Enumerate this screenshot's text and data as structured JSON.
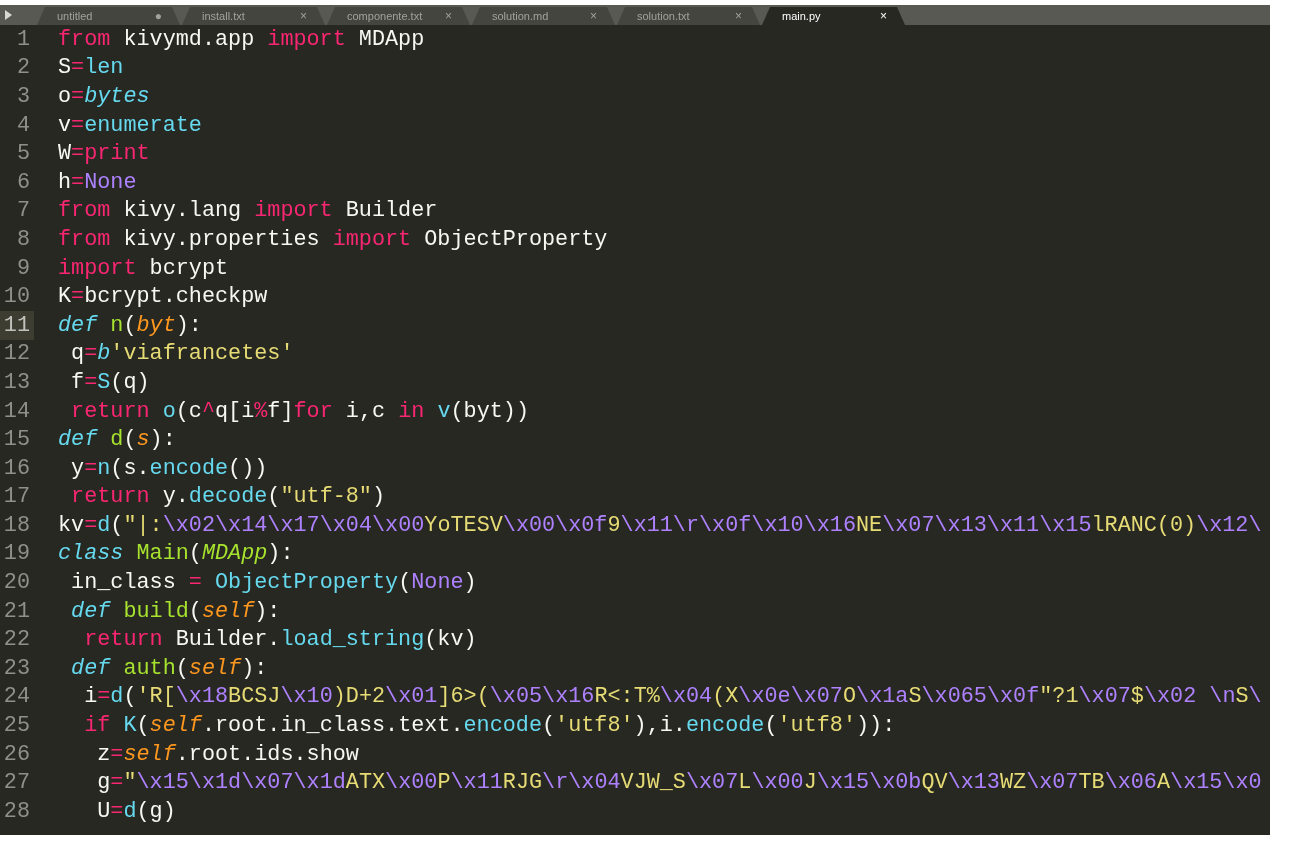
{
  "tabs": [
    {
      "label": "untitled",
      "marker": "●",
      "selected": false
    },
    {
      "label": "install.txt",
      "marker": "×",
      "selected": false
    },
    {
      "label": "componente.txt",
      "marker": "×",
      "selected": false
    },
    {
      "label": "solution.md",
      "marker": "×",
      "selected": false
    },
    {
      "label": "solution.txt",
      "marker": "×",
      "selected": false
    },
    {
      "label": "main.py",
      "marker": "×",
      "selected": true
    }
  ],
  "lines": [
    {
      "number": "1",
      "current": false,
      "tokens": [
        {
          "kind": "kw",
          "text": "from"
        },
        {
          "kind": "plain",
          "text": " kivymd.app "
        },
        {
          "kind": "kw",
          "text": "import"
        },
        {
          "kind": "plain",
          "text": " MDApp"
        }
      ]
    },
    {
      "number": "2",
      "current": false,
      "tokens": [
        {
          "kind": "plain",
          "text": "S"
        },
        {
          "kind": "kw",
          "text": "="
        },
        {
          "kind": "builtin",
          "text": "len"
        }
      ]
    },
    {
      "number": "3",
      "current": false,
      "tokens": [
        {
          "kind": "plain",
          "text": "o"
        },
        {
          "kind": "kw",
          "text": "="
        },
        {
          "kind": "storage",
          "text": "bytes"
        }
      ]
    },
    {
      "number": "4",
      "current": false,
      "tokens": [
        {
          "kind": "plain",
          "text": "v"
        },
        {
          "kind": "kw",
          "text": "="
        },
        {
          "kind": "builtin",
          "text": "enumerate"
        }
      ]
    },
    {
      "number": "5",
      "current": false,
      "tokens": [
        {
          "kind": "plain",
          "text": "W"
        },
        {
          "kind": "kw",
          "text": "="
        },
        {
          "kind": "kw",
          "text": "print"
        }
      ]
    },
    {
      "number": "6",
      "current": false,
      "tokens": [
        {
          "kind": "plain",
          "text": "h"
        },
        {
          "kind": "kw",
          "text": "="
        },
        {
          "kind": "const",
          "text": "None"
        }
      ]
    },
    {
      "number": "7",
      "current": false,
      "tokens": [
        {
          "kind": "kw",
          "text": "from"
        },
        {
          "kind": "plain",
          "text": " kivy.lang "
        },
        {
          "kind": "kw",
          "text": "import"
        },
        {
          "kind": "plain",
          "text": " Builder"
        }
      ]
    },
    {
      "number": "8",
      "current": false,
      "tokens": [
        {
          "kind": "kw",
          "text": "from"
        },
        {
          "kind": "plain",
          "text": " kivy.properties "
        },
        {
          "kind": "kw",
          "text": "import"
        },
        {
          "kind": "plain",
          "text": " ObjectProperty"
        }
      ]
    },
    {
      "number": "9",
      "current": false,
      "tokens": [
        {
          "kind": "kw",
          "text": "import"
        },
        {
          "kind": "plain",
          "text": " bcrypt"
        }
      ]
    },
    {
      "number": "10",
      "current": false,
      "tokens": [
        {
          "kind": "plain",
          "text": "K"
        },
        {
          "kind": "kw",
          "text": "="
        },
        {
          "kind": "plain",
          "text": "bcrypt.checkpw"
        }
      ]
    },
    {
      "number": "11",
      "current": true,
      "tokens": [
        {
          "kind": "storage",
          "text": "def"
        },
        {
          "kind": "fn",
          "text": " n"
        },
        {
          "kind": "plain",
          "text": "("
        },
        {
          "kind": "param",
          "text": "byt"
        },
        {
          "kind": "plain",
          "text": "):"
        }
      ]
    },
    {
      "number": "12",
      "current": false,
      "tokens": [
        {
          "kind": "plain",
          "text": " q"
        },
        {
          "kind": "kw",
          "text": "="
        },
        {
          "kind": "storage",
          "text": "b"
        },
        {
          "kind": "str",
          "text": "'viafrancetes'"
        }
      ]
    },
    {
      "number": "13",
      "current": false,
      "tokens": [
        {
          "kind": "plain",
          "text": " f"
        },
        {
          "kind": "kw",
          "text": "="
        },
        {
          "kind": "builtin",
          "text": "S"
        },
        {
          "kind": "plain",
          "text": "(q)"
        }
      ]
    },
    {
      "number": "14",
      "current": false,
      "tokens": [
        {
          "kind": "kw",
          "text": " return"
        },
        {
          "kind": "builtin",
          "text": " o"
        },
        {
          "kind": "plain",
          "text": "(c"
        },
        {
          "kind": "kw",
          "text": "^"
        },
        {
          "kind": "plain",
          "text": "q[i"
        },
        {
          "kind": "kw",
          "text": "%"
        },
        {
          "kind": "plain",
          "text": "f]"
        },
        {
          "kind": "kw",
          "text": "for"
        },
        {
          "kind": "plain",
          "text": " i,c "
        },
        {
          "kind": "kw",
          "text": "in"
        },
        {
          "kind": "builtin",
          "text": " v"
        },
        {
          "kind": "plain",
          "text": "(byt))"
        }
      ]
    },
    {
      "number": "15",
      "current": false,
      "tokens": [
        {
          "kind": "storage",
          "text": "def"
        },
        {
          "kind": "fn",
          "text": " d"
        },
        {
          "kind": "plain",
          "text": "("
        },
        {
          "kind": "param",
          "text": "s"
        },
        {
          "kind": "plain",
          "text": "):"
        }
      ]
    },
    {
      "number": "16",
      "current": false,
      "tokens": [
        {
          "kind": "plain",
          "text": " y"
        },
        {
          "kind": "kw",
          "text": "="
        },
        {
          "kind": "builtin",
          "text": "n"
        },
        {
          "kind": "plain",
          "text": "(s."
        },
        {
          "kind": "builtin",
          "text": "encode"
        },
        {
          "kind": "plain",
          "text": "())"
        }
      ]
    },
    {
      "number": "17",
      "current": false,
      "tokens": [
        {
          "kind": "kw",
          "text": " return"
        },
        {
          "kind": "plain",
          "text": " y."
        },
        {
          "kind": "builtin",
          "text": "decode"
        },
        {
          "kind": "plain",
          "text": "("
        },
        {
          "kind": "str",
          "text": "\"utf-8\""
        },
        {
          "kind": "plain",
          "text": ")"
        }
      ]
    },
    {
      "number": "18",
      "current": false,
      "tokens": [
        {
          "kind": "plain",
          "text": "kv"
        },
        {
          "kind": "kw",
          "text": "="
        },
        {
          "kind": "builtin",
          "text": "d"
        },
        {
          "kind": "plain",
          "text": "("
        },
        {
          "kind": "str",
          "text": "\"|:"
        },
        {
          "kind": "const",
          "text": "\\x02\\x14\\x17\\x04\\x00"
        },
        {
          "kind": "str",
          "text": "YoTESV"
        },
        {
          "kind": "const",
          "text": "\\x00\\x0f"
        },
        {
          "kind": "str",
          "text": "9"
        },
        {
          "kind": "const",
          "text": "\\x11\\r\\x0f\\x10\\x16"
        },
        {
          "kind": "str",
          "text": "NE"
        },
        {
          "kind": "const",
          "text": "\\x07\\x13\\x11\\x15"
        },
        {
          "kind": "str",
          "text": "lRANC(0)"
        },
        {
          "kind": "const",
          "text": "\\x12\\"
        }
      ]
    },
    {
      "number": "19",
      "current": false,
      "tokens": [
        {
          "kind": "storage",
          "text": "class"
        },
        {
          "kind": "fn",
          "text": " Main"
        },
        {
          "kind": "plain",
          "text": "("
        },
        {
          "kind": "inherit",
          "text": "MDApp"
        },
        {
          "kind": "plain",
          "text": "):"
        }
      ]
    },
    {
      "number": "20",
      "current": false,
      "tokens": [
        {
          "kind": "plain",
          "text": " in_class "
        },
        {
          "kind": "kw",
          "text": "="
        },
        {
          "kind": "builtin",
          "text": " ObjectProperty"
        },
        {
          "kind": "plain",
          "text": "("
        },
        {
          "kind": "const",
          "text": "None"
        },
        {
          "kind": "plain",
          "text": ")"
        }
      ]
    },
    {
      "number": "21",
      "current": false,
      "tokens": [
        {
          "kind": "storage",
          "text": " def"
        },
        {
          "kind": "fn",
          "text": " build"
        },
        {
          "kind": "plain",
          "text": "("
        },
        {
          "kind": "param",
          "text": "self"
        },
        {
          "kind": "plain",
          "text": "):"
        }
      ]
    },
    {
      "number": "22",
      "current": false,
      "tokens": [
        {
          "kind": "kw",
          "text": "  return"
        },
        {
          "kind": "plain",
          "text": " Builder."
        },
        {
          "kind": "builtin",
          "text": "load_string"
        },
        {
          "kind": "plain",
          "text": "(kv)"
        }
      ]
    },
    {
      "number": "23",
      "current": false,
      "tokens": [
        {
          "kind": "storage",
          "text": " def"
        },
        {
          "kind": "fn",
          "text": " auth"
        },
        {
          "kind": "plain",
          "text": "("
        },
        {
          "kind": "param",
          "text": "self"
        },
        {
          "kind": "plain",
          "text": "):"
        }
      ]
    },
    {
      "number": "24",
      "current": false,
      "tokens": [
        {
          "kind": "plain",
          "text": "  i"
        },
        {
          "kind": "kw",
          "text": "="
        },
        {
          "kind": "builtin",
          "text": "d"
        },
        {
          "kind": "plain",
          "text": "("
        },
        {
          "kind": "str",
          "text": "'R["
        },
        {
          "kind": "const",
          "text": "\\x18"
        },
        {
          "kind": "str",
          "text": "BCSJ"
        },
        {
          "kind": "const",
          "text": "\\x10"
        },
        {
          "kind": "str",
          "text": ")D+2"
        },
        {
          "kind": "const",
          "text": "\\x01"
        },
        {
          "kind": "str",
          "text": "]6>("
        },
        {
          "kind": "const",
          "text": "\\x05\\x16"
        },
        {
          "kind": "str",
          "text": "R<:T%"
        },
        {
          "kind": "const",
          "text": "\\x04"
        },
        {
          "kind": "str",
          "text": "(X"
        },
        {
          "kind": "const",
          "text": "\\x0e\\x07"
        },
        {
          "kind": "str",
          "text": "O"
        },
        {
          "kind": "const",
          "text": "\\x1a"
        },
        {
          "kind": "str",
          "text": "S"
        },
        {
          "kind": "const",
          "text": "\\x065"
        },
        {
          "kind": "const",
          "text": "\\x0f"
        },
        {
          "kind": "str",
          "text": "\"?1"
        },
        {
          "kind": "const",
          "text": "\\x07"
        },
        {
          "kind": "str",
          "text": "$"
        },
        {
          "kind": "const",
          "text": "\\x02"
        },
        {
          "kind": "const",
          "text": " \\n"
        },
        {
          "kind": "str",
          "text": "S"
        },
        {
          "kind": "const",
          "text": "\\"
        }
      ]
    },
    {
      "number": "25",
      "current": false,
      "tokens": [
        {
          "kind": "kw",
          "text": "  if"
        },
        {
          "kind": "builtin",
          "text": " K"
        },
        {
          "kind": "plain",
          "text": "("
        },
        {
          "kind": "param",
          "text": "self"
        },
        {
          "kind": "plain",
          "text": ".root.in_class.text."
        },
        {
          "kind": "builtin",
          "text": "encode"
        },
        {
          "kind": "plain",
          "text": "("
        },
        {
          "kind": "str",
          "text": "'utf8'"
        },
        {
          "kind": "plain",
          "text": "),i."
        },
        {
          "kind": "builtin",
          "text": "encode"
        },
        {
          "kind": "plain",
          "text": "("
        },
        {
          "kind": "str",
          "text": "'utf8'"
        },
        {
          "kind": "plain",
          "text": ")):"
        }
      ]
    },
    {
      "number": "26",
      "current": false,
      "tokens": [
        {
          "kind": "plain",
          "text": "   z"
        },
        {
          "kind": "kw",
          "text": "="
        },
        {
          "kind": "param",
          "text": "self"
        },
        {
          "kind": "plain",
          "text": ".root.ids.show"
        }
      ]
    },
    {
      "number": "27",
      "current": false,
      "tokens": [
        {
          "kind": "plain",
          "text": "   g"
        },
        {
          "kind": "kw",
          "text": "="
        },
        {
          "kind": "str",
          "text": "\""
        },
        {
          "kind": "const",
          "text": "\\x15\\x1d\\x07\\x1d"
        },
        {
          "kind": "str",
          "text": "ATX"
        },
        {
          "kind": "const",
          "text": "\\x00"
        },
        {
          "kind": "str",
          "text": "P"
        },
        {
          "kind": "const",
          "text": "\\x11"
        },
        {
          "kind": "str",
          "text": "RJG"
        },
        {
          "kind": "const",
          "text": "\\r\\x04"
        },
        {
          "kind": "str",
          "text": "VJW_S"
        },
        {
          "kind": "const",
          "text": "\\x07"
        },
        {
          "kind": "str",
          "text": "L"
        },
        {
          "kind": "const",
          "text": "\\x00"
        },
        {
          "kind": "str",
          "text": "J"
        },
        {
          "kind": "const",
          "text": "\\x15\\x0b"
        },
        {
          "kind": "str",
          "text": "QV"
        },
        {
          "kind": "const",
          "text": "\\x13"
        },
        {
          "kind": "str",
          "text": "WZ"
        },
        {
          "kind": "const",
          "text": "\\x07"
        },
        {
          "kind": "str",
          "text": "TB"
        },
        {
          "kind": "const",
          "text": "\\x06"
        },
        {
          "kind": "str",
          "text": "A"
        },
        {
          "kind": "const",
          "text": "\\x15\\x0"
        }
      ]
    },
    {
      "number": "28",
      "current": false,
      "tokens": [
        {
          "kind": "plain",
          "text": "   U"
        },
        {
          "kind": "kw",
          "text": "="
        },
        {
          "kind": "builtin",
          "text": "d"
        },
        {
          "kind": "plain",
          "text": "(g)"
        }
      ]
    }
  ]
}
